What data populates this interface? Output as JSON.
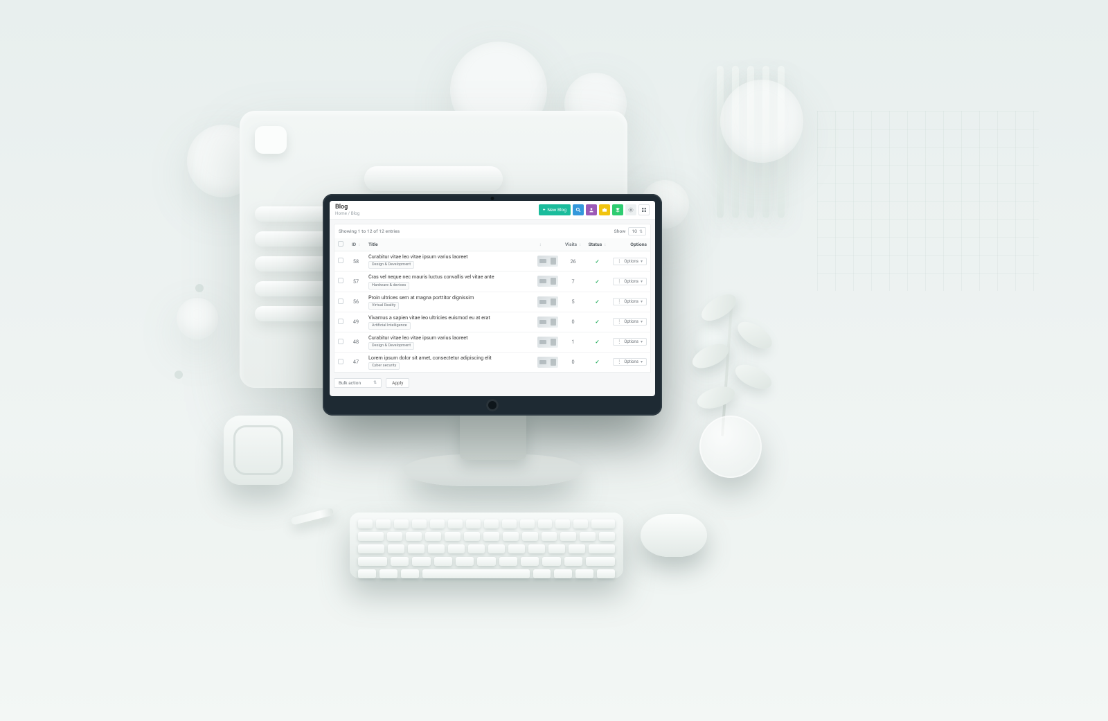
{
  "header": {
    "title": "Blog",
    "breadcrumb_home": "Home",
    "breadcrumb_sep": " / ",
    "breadcrumb_current": "Blog",
    "new_button": "New Blog"
  },
  "toolbar_icons": {
    "search": "search-icon",
    "user": "user-icon",
    "briefcase": "briefcase-icon",
    "layers": "layers-icon",
    "gear": "gear-icon",
    "grid": "grid-icon"
  },
  "listbar": {
    "summary": "Showing 1 to 12 of 12 entries",
    "show_label": "Show",
    "show_value": "10"
  },
  "columns": {
    "id": "ID",
    "title": "Title",
    "visits": "Visits",
    "status": "Status",
    "options": "Options"
  },
  "options_label": "Options",
  "status_true_glyph": "✓",
  "rows": [
    {
      "id": "58",
      "title": "Curabitur vitae leo vitae ipsum varius laoreet",
      "tag": "Design & Development",
      "visits": "26",
      "status": true
    },
    {
      "id": "57",
      "title": "Cras vel neque nec mauris luctus convallis vel vitae ante",
      "tag": "Hardware & devices",
      "visits": "7",
      "status": true
    },
    {
      "id": "56",
      "title": "Proin ultrices sem at magna porttitor dignissim",
      "tag": "Virtual Reality",
      "visits": "5",
      "status": true
    },
    {
      "id": "49",
      "title": "Vivamus a sapien vitae leo ultricies euismod eu at erat",
      "tag": "Artificial Intelligence",
      "visits": "0",
      "status": true
    },
    {
      "id": "48",
      "title": "Curabitur vitae leo vitae ipsum varius laoreet",
      "tag": "Design & Development",
      "visits": "1",
      "status": true
    },
    {
      "id": "47",
      "title": "Lorem ipsum dolor sit amet, consectetur adipiscing elit",
      "tag": "Cyber security",
      "visits": "0",
      "status": true
    }
  ],
  "bulk": {
    "select_label": "Bulk action",
    "apply_label": "Apply"
  },
  "colors": {
    "teal": "#1abc9c",
    "blue": "#3498db",
    "purple": "#9b59b6",
    "amber": "#f1c40f",
    "green": "#2ecc71",
    "status_ok": "#27ae60"
  }
}
